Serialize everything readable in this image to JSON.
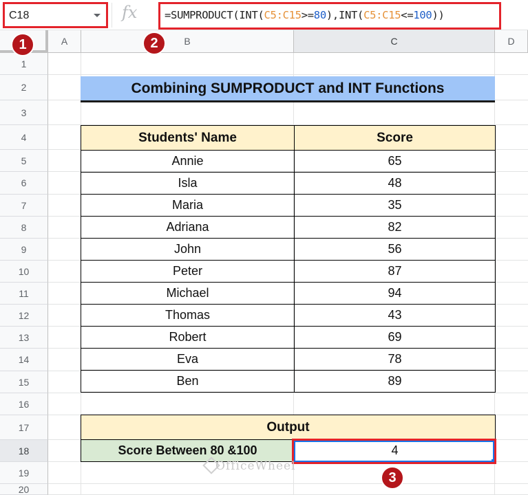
{
  "formula_bar": {
    "name_box": "C18",
    "fx_label": "fx",
    "formula_parts": [
      {
        "text": "=SUMPRODUCT(INT(",
        "kind": "plain"
      },
      {
        "text": "C5:C15",
        "kind": "ref"
      },
      {
        "text": ">=",
        "kind": "plain"
      },
      {
        "text": "80",
        "kind": "num"
      },
      {
        "text": "),INT(",
        "kind": "plain"
      },
      {
        "text": "C5:C15",
        "kind": "ref"
      },
      {
        "text": "<=",
        "kind": "plain"
      },
      {
        "text": "100",
        "kind": "num"
      },
      {
        "text": "))",
        "kind": "plain"
      }
    ]
  },
  "columns": [
    "A",
    "B",
    "C",
    "D"
  ],
  "rows": [
    "1",
    "2",
    "3",
    "4",
    "5",
    "6",
    "7",
    "8",
    "9",
    "10",
    "11",
    "12",
    "13",
    "14",
    "15",
    "16",
    "17",
    "18",
    "19",
    "20"
  ],
  "selected": {
    "column": "C",
    "row": "18"
  },
  "title": "Combining SUMPRODUCT and INT Functions",
  "table": {
    "headers": [
      "Students' Name",
      "Score"
    ],
    "rows": [
      [
        "Annie",
        "65"
      ],
      [
        "Isla",
        "48"
      ],
      [
        "Maria",
        "35"
      ],
      [
        "Adriana",
        "82"
      ],
      [
        "John",
        "56"
      ],
      [
        "Peter",
        "87"
      ],
      [
        "Michael",
        "94"
      ],
      [
        "Thomas",
        "43"
      ],
      [
        "Robert",
        "69"
      ],
      [
        "Eva",
        "78"
      ],
      [
        "Ben",
        "89"
      ]
    ]
  },
  "output": {
    "header": "Output",
    "label": "Score Between 80 &100",
    "value": "4"
  },
  "markers": [
    "1",
    "2",
    "3"
  ],
  "watermark": "OfficeWheel",
  "colors": {
    "highlight_red": "#e3232b",
    "marker_red": "#b4161b",
    "title_blue": "#9fc5f8",
    "header_yellow": "#fff2cc",
    "label_green": "#d9ead3",
    "ref_orange": "#e69138",
    "num_blue": "#1f5fc8"
  }
}
